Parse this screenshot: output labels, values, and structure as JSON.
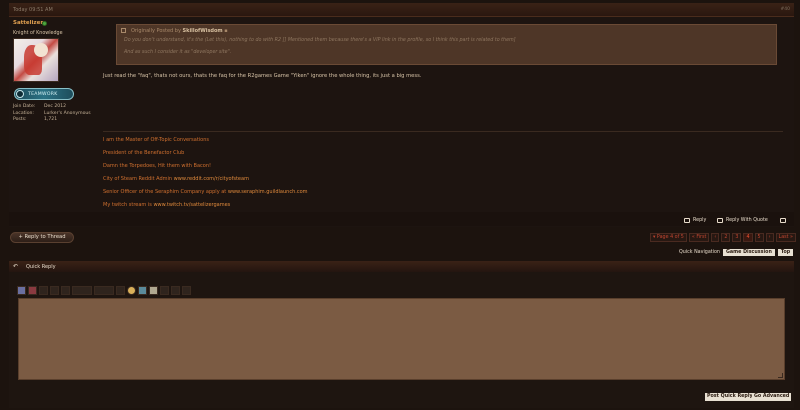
{
  "post": {
    "date": "Today 09:51 AM",
    "number": "#40"
  },
  "user": {
    "name": "Sattelizer",
    "title": "Knight of Knowledge",
    "badge_text": "TEAMWORK",
    "stats": [
      {
        "key": "Join Date:",
        "value": "Dec 2012"
      },
      {
        "key": "Location:",
        "value": "Lurker's Anonymous"
      },
      {
        "key": "Posts:",
        "value": "1,721"
      }
    ]
  },
  "quote": {
    "prefix": "Originally Posted by",
    "author": "SkillofWisdom",
    "lines": [
      "Do you don't understand, it's the (Let this), nothing to do with R2 [] Mentioned them because there's a VIP link in the profile, so I think this part is related to them]",
      "And as such I consider it as \"developer site\"."
    ]
  },
  "message": "Just read the \"faq\", thats not ours, thats the faq for the R2games Game \"Yiken\" ignore the whole thing, its just a big mess.",
  "signature": [
    {
      "text": "I am the Master of Off-Topic Conversations",
      "link": ""
    },
    {
      "text": "President of the Benefactor Club",
      "link": ""
    },
    {
      "text": "Damn the Torpedoes, Hit them with Bacon!",
      "link": ""
    },
    {
      "text": "City of Steam Reddit Admin ",
      "link": "www.reddit.com/r/cityofsteam"
    },
    {
      "text": "Senior Officer of the Seraphim Company apply at ",
      "link": "www.seraphim.guildlaunch.com"
    },
    {
      "text": "My twitch stream is ",
      "link": "www.twitch.tv/sattelizergames"
    }
  ],
  "actions": {
    "reply": "Reply",
    "reply_quote": "Reply With Quote"
  },
  "thread": {
    "reply_to_thread": "+ Reply to Thread",
    "page_label": "▾ Page 4 of 5",
    "first": "« First",
    "prev": "‹",
    "pages": [
      "2",
      "3",
      "4",
      "5"
    ],
    "current_page": "4",
    "next": "›",
    "last": "Last »"
  },
  "quick_nav": {
    "label": "Quick Navigation",
    "section": "Game Discussion",
    "top": "Top"
  },
  "quick_reply": {
    "title": "Quick Reply",
    "post_button": "Post Quick Reply",
    "advanced_button": "Go Advanced"
  },
  "colors": {
    "accent": "#e08a3c",
    "background": "#1c130e",
    "editor": "#7b5b43"
  }
}
